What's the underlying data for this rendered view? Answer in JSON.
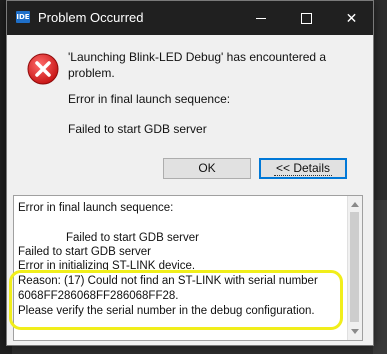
{
  "window": {
    "app_icon": "IDE",
    "title": "Problem Occurred",
    "minimize_icon": "minimize-icon",
    "maximize_icon": "maximize-icon",
    "close_icon": "close-icon"
  },
  "dialog": {
    "icon": "error-icon",
    "message": "'Launching Blink-LED Debug' has encountered a problem.",
    "error_heading": "Error in final launch sequence:",
    "error_detail": "Failed to start GDB server"
  },
  "buttons": {
    "ok": "OK",
    "details": "<< Details"
  },
  "details": {
    "lines": [
      "Error in final launch sequence:",
      "",
      "Failed to start GDB server",
      "Failed to start GDB server",
      "Error in initializing ST-LINK device.",
      "Reason: (17) Could not find an ST-LINK with serial number",
      "6068FF286068FF286068FF28.",
      "Please verify the serial number in the debug configuration."
    ]
  },
  "colors": {
    "highlight": "#f1ee1a",
    "titlebar": "#202020",
    "error": "#e81123"
  }
}
